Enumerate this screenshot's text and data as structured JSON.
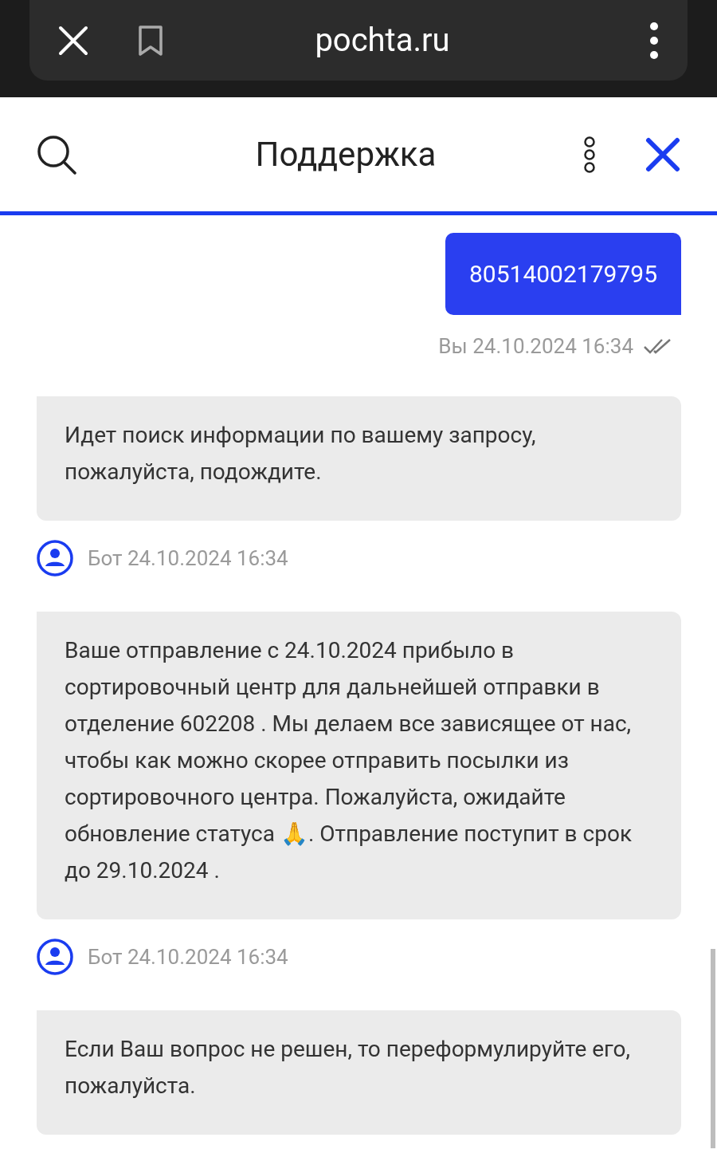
{
  "browser_bar": {
    "url": "pochta.ru"
  },
  "header": {
    "title": "Поддержка"
  },
  "messages": [
    {
      "kind": "user_bubble",
      "text": "80514002179795"
    },
    {
      "kind": "user_meta",
      "text": "Вы 24.10.2024 16:34",
      "read": true
    },
    {
      "kind": "bot_bubble",
      "text": "Идет поиск информации по вашему запросу, пожалуйста, подождите."
    },
    {
      "kind": "bot_meta",
      "text": "Бот 24.10.2024 16:34"
    },
    {
      "kind": "bot_bubble",
      "text": "Ваше отправление с 24.10.2024 прибыло в сортировочный центр для дальнейшей отправки в отделение 602208 . Мы делаем все зависящее от нас, чтобы как можно скорее отправить посылки из сортировочного центра. Пожалуйста, ожидайте обновление статуса 🙏. Отправление поступит в срок до 29.10.2024 ."
    },
    {
      "kind": "bot_meta",
      "text": "Бот 24.10.2024 16:34"
    },
    {
      "kind": "bot_bubble",
      "text": "Если Ваш вопрос не решен, то переформулируйте его, пожалуйста."
    }
  ]
}
